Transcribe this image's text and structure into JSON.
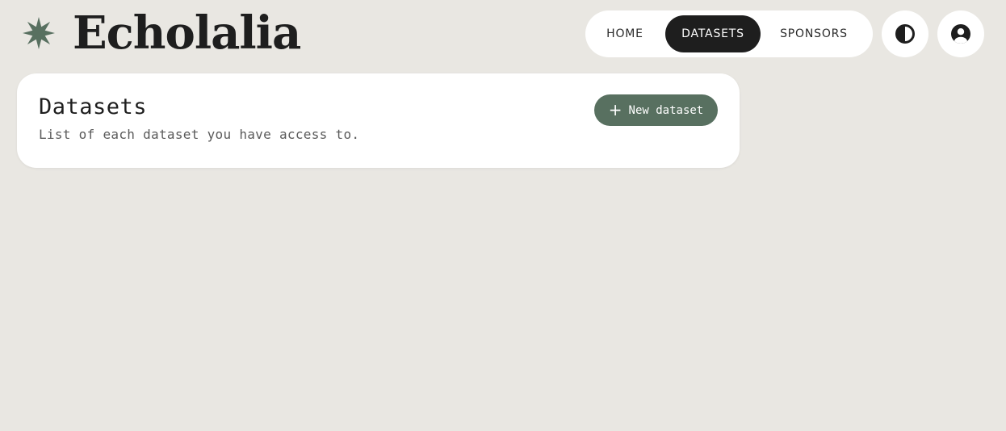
{
  "app": {
    "name": "Echolalia",
    "logo_icon": "eight-point-star-icon",
    "brand_color": "#587060"
  },
  "nav": {
    "tabs": [
      {
        "label": "HOME"
      },
      {
        "label": "DATASETS",
        "active": true
      },
      {
        "label": "SPONSORS"
      }
    ],
    "theme_toggle_icon": "contrast-icon",
    "account_icon": "user-circle-icon"
  },
  "datasets_card": {
    "title": "Datasets",
    "subtitle": "List of each dataset you have access to.",
    "new_button": {
      "icon": "+",
      "label": "New dataset"
    }
  },
  "colors": {
    "background": "#e9e7e2",
    "active_tab": "#1e1e1e",
    "button": "#587060"
  }
}
